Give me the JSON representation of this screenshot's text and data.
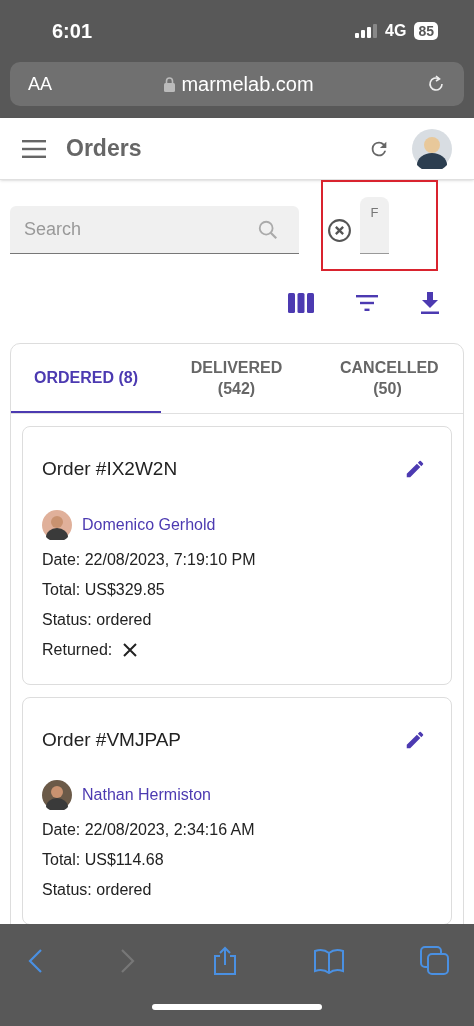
{
  "status_bar": {
    "time": "6:01",
    "network": "4G",
    "battery": "85"
  },
  "browser": {
    "text_size_button": "AA",
    "url": "marmelab.com"
  },
  "app_bar": {
    "title": "Orders"
  },
  "search": {
    "placeholder": "Search"
  },
  "annotated_field": {
    "label": "F"
  },
  "tabs": [
    {
      "label": "ORDERED (8)",
      "selected": true
    },
    {
      "label": "DELIVERED (542)",
      "selected": false
    },
    {
      "label": "CANCELLED (50)",
      "selected": false
    }
  ],
  "orders": [
    {
      "title": "Order #IX2W2N",
      "customer": "Domenico Gerhold",
      "date": "Date: 22/08/2023, 7:19:10 PM",
      "total": "Total: US$329.85",
      "status": "Status: ordered",
      "returned_label": "Returned:",
      "returned": false
    },
    {
      "title": "Order #VMJPAP",
      "customer": "Nathan Hermiston",
      "date": "Date: 22/08/2023, 2:34:16 AM",
      "total": "Total: US$114.68",
      "status": "Status: ordered"
    }
  ]
}
